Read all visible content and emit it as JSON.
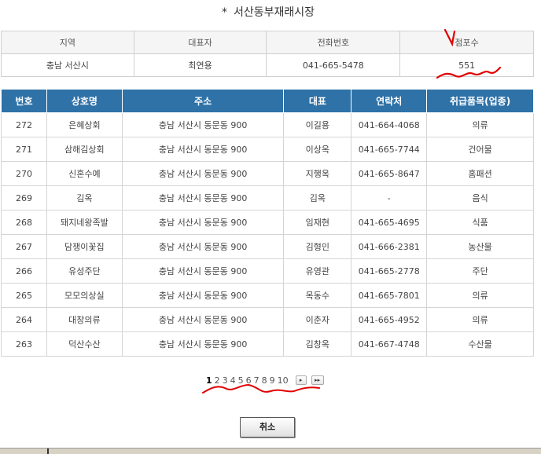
{
  "page": {
    "title": "서산동부재래시장",
    "title_prefix": "*"
  },
  "summary": {
    "headers": [
      "지역",
      "대표자",
      "전화번호",
      "점포수"
    ],
    "values": [
      "충남 서산시",
      "최연용",
      "041-665-5478",
      "551"
    ]
  },
  "shops": {
    "headers": [
      "번호",
      "상호명",
      "주소",
      "대표",
      "연락처",
      "취급품목(업종)"
    ],
    "rows": [
      [
        "272",
        "은혜상회",
        "충남 서산시 동문동 900",
        "이길용",
        "041-664-4068",
        "의류"
      ],
      [
        "271",
        "삼해김상회",
        "충남 서산시 동문동 900",
        "이상옥",
        "041-665-7744",
        "건어물"
      ],
      [
        "270",
        "신혼수예",
        "충남 서산시 동문동 900",
        "지행옥",
        "041-665-8647",
        "홈패션"
      ],
      [
        "269",
        "김옥",
        "충남 서산시 동문동 900",
        "김옥",
        "-",
        "음식"
      ],
      [
        "268",
        "돼지네왕족발",
        "충남 서산시 동문동 900",
        "임재현",
        "041-665-4695",
        "식품"
      ],
      [
        "267",
        "담쟁이꽃집",
        "충남 서산시 동문동 900",
        "김형인",
        "041-666-2381",
        "농산물"
      ],
      [
        "266",
        "유성주단",
        "충남 서산시 동문동 900",
        "유영관",
        "041-665-2778",
        "주단"
      ],
      [
        "265",
        "모모의상실",
        "충남 서산시 동문동 900",
        "목동수",
        "041-665-7801",
        "의류"
      ],
      [
        "264",
        "대창의류",
        "충남 서산시 동문동 900",
        "이춘자",
        "041-665-4952",
        "의류"
      ],
      [
        "263",
        "덕산수산",
        "충남 서산시 동문동 900",
        "김창옥",
        "041-667-4748",
        "수산물"
      ]
    ]
  },
  "pager": {
    "current": "1",
    "pages": [
      "1",
      "2",
      "3",
      "4",
      "5",
      "6",
      "7",
      "8",
      "9",
      "10"
    ],
    "next_icon": "next-page-icon",
    "last_icon": "last-page-icon",
    "next_glyph": "▸",
    "last_glyph": "▸▸"
  },
  "actions": {
    "cancel_label": "취소"
  },
  "annotations": {
    "color": "#e00000"
  },
  "colors": {
    "header_bg": "#2e72a8",
    "summary_header_bg": "#f5f5f5"
  }
}
